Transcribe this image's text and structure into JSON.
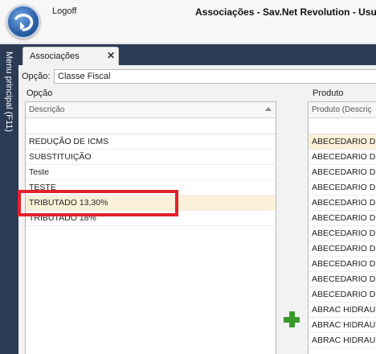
{
  "topbar": {
    "logoff_label": "Logoff",
    "title": "Associações - Sav.Net Revolution - Usuá"
  },
  "leftbar": {
    "label": "Menu principal (F11)"
  },
  "tabs": [
    {
      "label": "Associações",
      "close": "✕"
    }
  ],
  "opcao_field": {
    "label": "Opção:",
    "value": "Classe Fiscal"
  },
  "left_panel": {
    "title": "Opção",
    "column_header": "Descrição",
    "rows": [
      "REDUÇÃO DE ICMS",
      "SUBSTITUIÇÃO",
      "Teste",
      "TESTE",
      "TRIBUTADO 13,30%",
      "TRIBUTADO 18%"
    ],
    "selected_index": 4
  },
  "right_panel": {
    "title": "Produto",
    "column_header": "Produto (Descriç",
    "rows": [
      "ABECEDARIO DE",
      "ABECEDARIO DE",
      "ABECEDARIO DE",
      "ABECEDARIO DE",
      "ABECEDARIO DE",
      "ABECEDARIO DE",
      "ABECEDARIO DE",
      "ABECEDARIO DE",
      "ABECEDARIO DE",
      "ABECEDARIO DE",
      "ABECEDARIO DE",
      "ABRAC HIDRAUL",
      "ABRAC HIDRAUL",
      "ABRAC HIDRAUL"
    ]
  },
  "icons": {
    "app_orb": "refresh-arrow-icon",
    "add": "plus-icon"
  },
  "colors": {
    "sidebar": "#2b3a55",
    "highlight": "#e3212b",
    "add_green": "#3a9a2a",
    "selected_row": "#fbf1d8"
  }
}
